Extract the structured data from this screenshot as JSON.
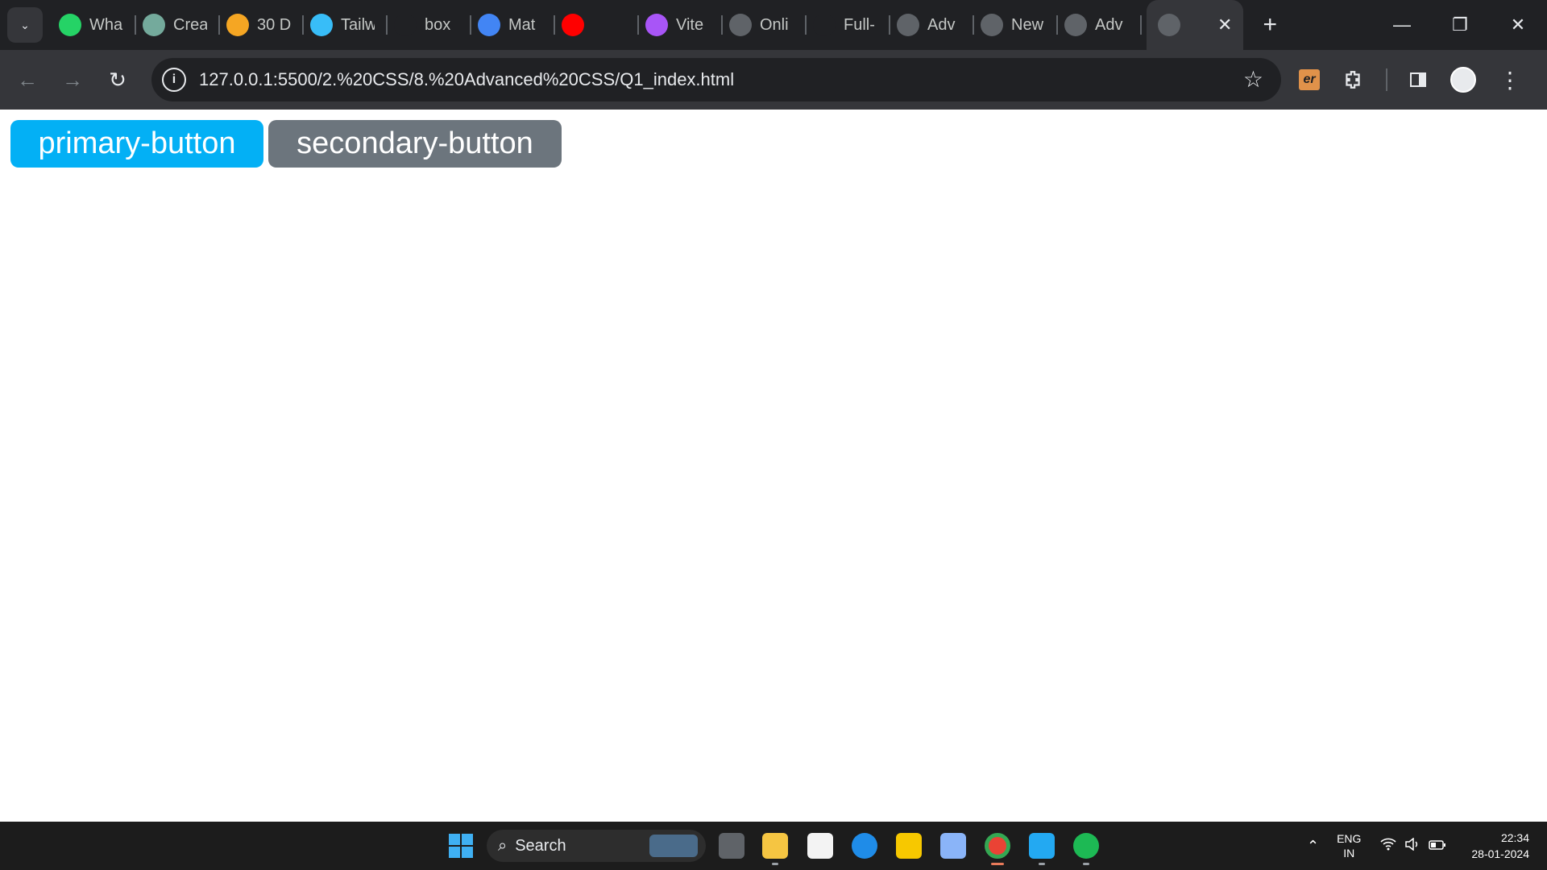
{
  "browser": {
    "tabs": [
      {
        "title": "Wha",
        "icon": "whatsapp-icon",
        "color": "#25d366"
      },
      {
        "title": "Crea",
        "icon": "chatgpt-icon",
        "color": "#74aa9c"
      },
      {
        "title": "30 D",
        "icon": "codewars-icon",
        "color": "#f5a623"
      },
      {
        "title": "Tailw",
        "icon": "tailwind-icon",
        "color": "#38bdf8"
      },
      {
        "title": "box",
        "icon": "medium-icon",
        "color": "#202124"
      },
      {
        "title": "Mat",
        "icon": "mat-icon",
        "color": "#4285f4"
      },
      {
        "title": "",
        "icon": "youtube-icon",
        "color": "#ff0000"
      },
      {
        "title": "Vite",
        "icon": "vite-icon",
        "color": "#a855f7"
      },
      {
        "title": "Onli",
        "icon": "wordpress-icon",
        "color": "#5f6368"
      },
      {
        "title": "Full-",
        "icon": "github-icon",
        "color": "#202124"
      },
      {
        "title": "Adv",
        "icon": "globe-icon",
        "color": "#5f6368"
      },
      {
        "title": "New",
        "icon": "chrome-icon",
        "color": "#5f6368"
      },
      {
        "title": "Adv",
        "icon": "globe-icon",
        "color": "#5f6368"
      }
    ],
    "active_tab": {
      "icon": "globe-icon",
      "close": "✕"
    },
    "new_tab": "+",
    "window_controls": {
      "minimize": "—",
      "restore": "❐",
      "close": "✕"
    },
    "url": "127.0.0.1:5500/2.%20CSS/8.%20Advanced%20CSS/Q1_index.html",
    "ext_er": "er"
  },
  "page": {
    "primary_button": "primary-button",
    "secondary_button": "secondary-button",
    "primary_color": "#03b0f5",
    "secondary_color": "#6c757d"
  },
  "taskbar": {
    "search_label": "Search",
    "lang_top": "ENG",
    "lang_bottom": "IN",
    "time": "22:34",
    "date": "28-01-2024"
  }
}
